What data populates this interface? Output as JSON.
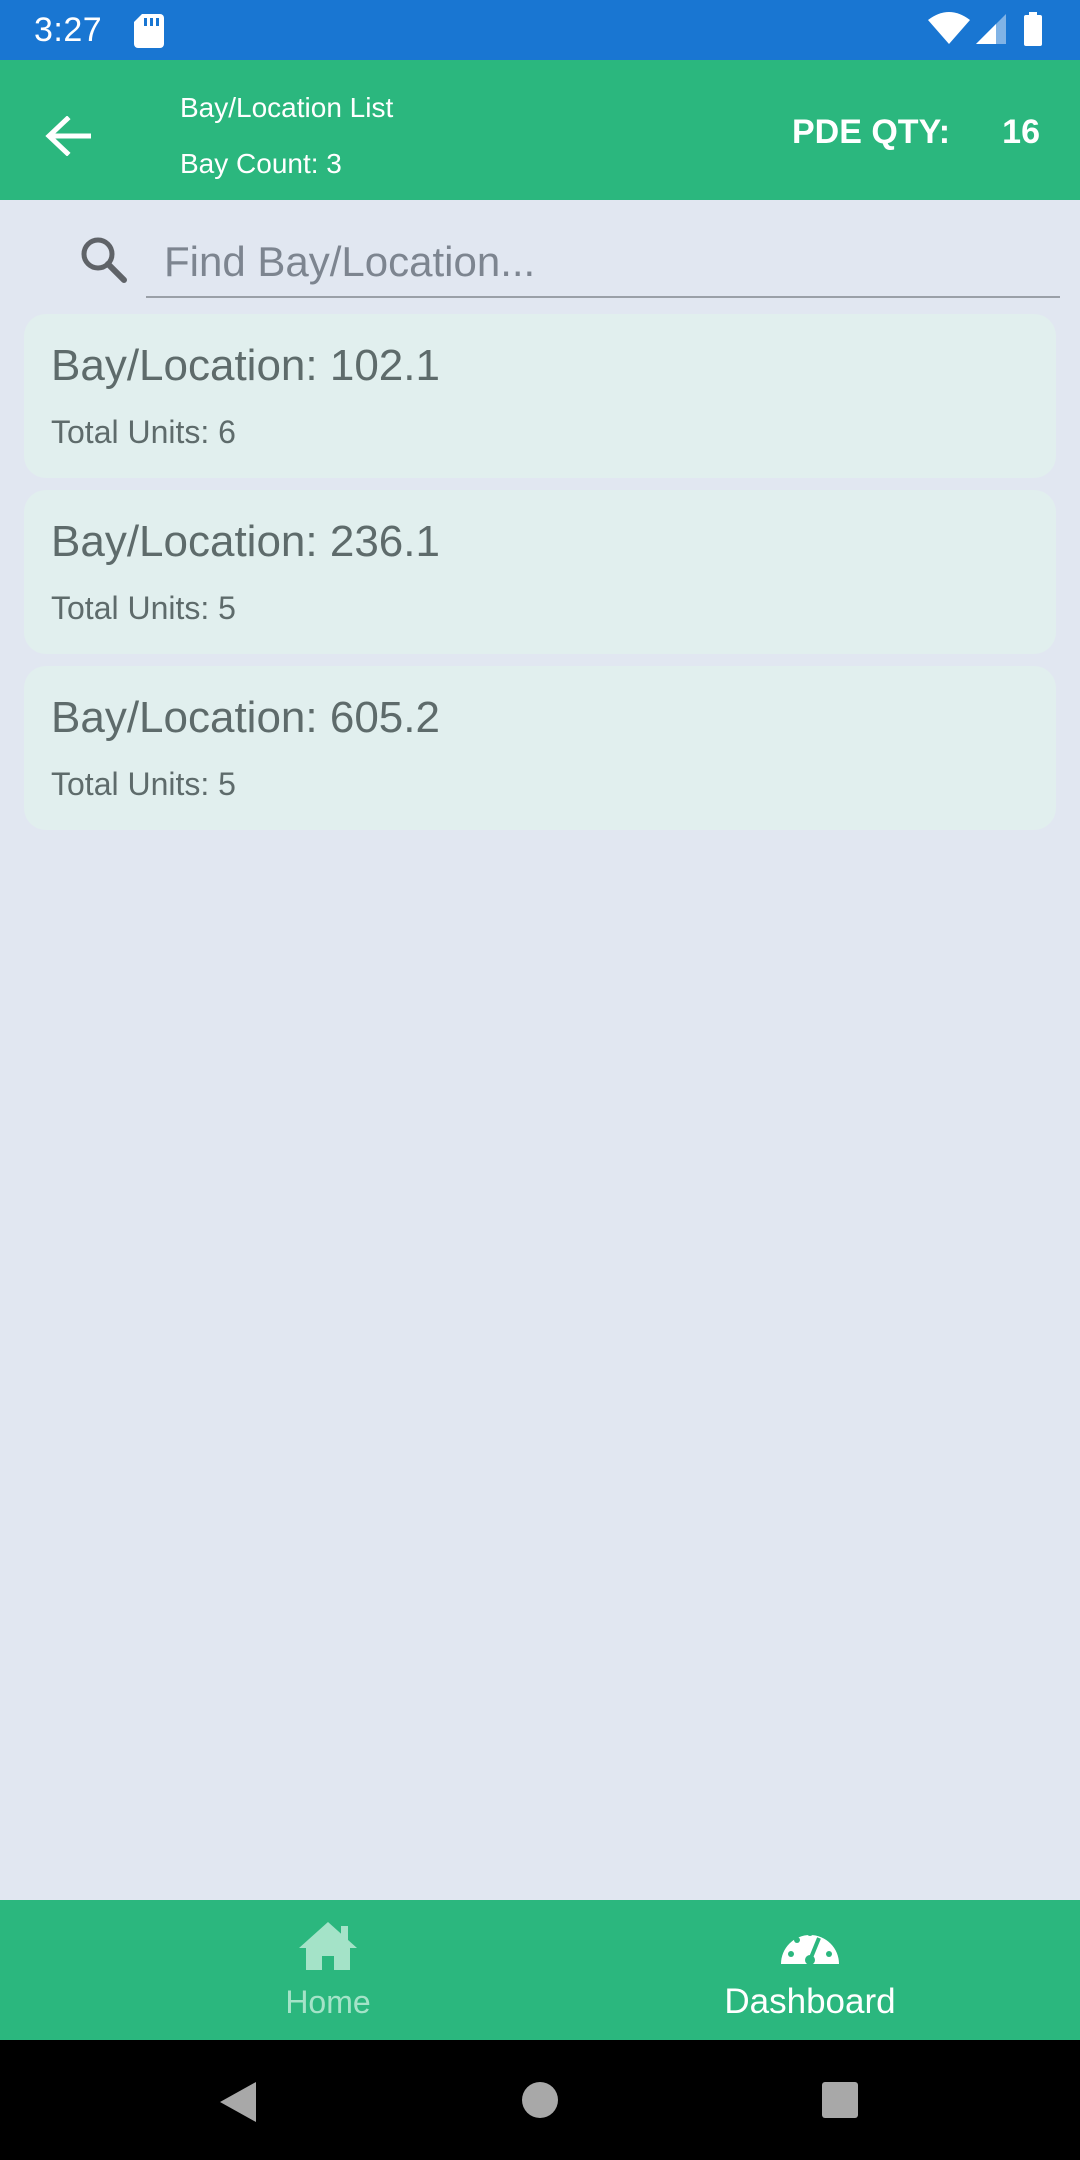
{
  "status_bar": {
    "time": "3:27",
    "icons": [
      "sd-card-icon",
      "wifi-icon",
      "cell-signal-icon",
      "battery-icon"
    ],
    "background": "#1976d2"
  },
  "app_bar": {
    "title": "Bay/Location List",
    "subtitle": "Bay Count: 3",
    "pde_label": "PDE QTY:",
    "pde_value": "16",
    "back_icon": "arrow-left-icon",
    "background": "#2bb77e"
  },
  "search": {
    "placeholder": "Find Bay/Location...",
    "value": "",
    "icon": "search-icon"
  },
  "bays": [
    {
      "location": "Bay/Location: 102.1",
      "units": "Total Units: 6"
    },
    {
      "location": "Bay/Location: 236.1",
      "units": "Total Units: 5"
    },
    {
      "location": "Bay/Location: 605.2",
      "units": "Total Units: 5"
    }
  ],
  "bottom_nav": {
    "items": [
      {
        "label": "Home",
        "icon": "home-icon",
        "active": false
      },
      {
        "label": "Dashboard",
        "icon": "dashboard-gauge-icon",
        "active": true
      }
    ]
  },
  "system_nav": {
    "icons": [
      "back-triangle-icon",
      "home-circle-icon",
      "recents-square-icon"
    ]
  },
  "colors": {
    "accent": "#2bb77e",
    "page_background": "#e1e7f1",
    "card_background": "#e1efee",
    "card_text": "#5e6b6b"
  }
}
